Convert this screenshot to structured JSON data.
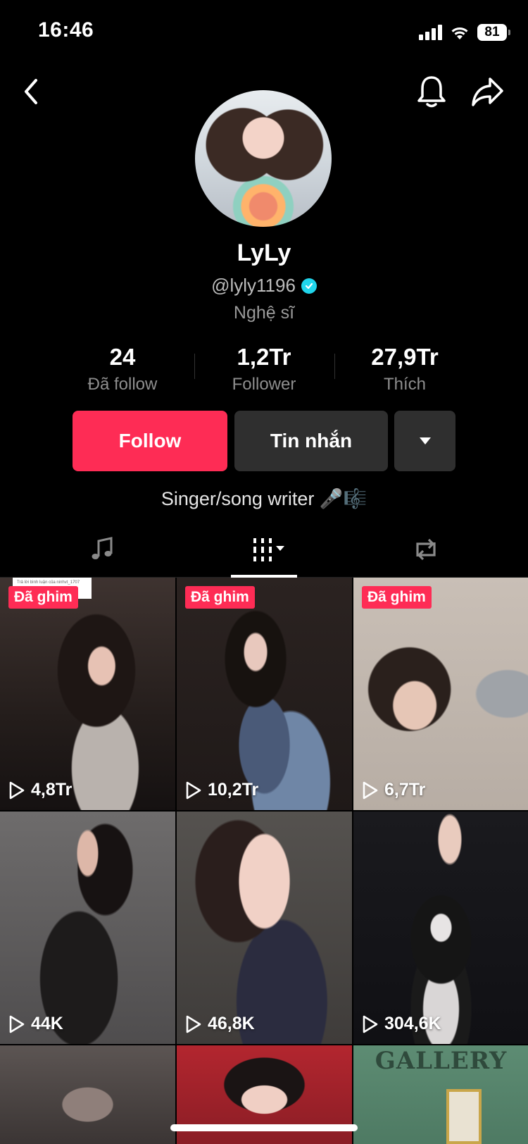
{
  "status_bar": {
    "time": "16:46",
    "battery": "81"
  },
  "profile": {
    "name": "LyLy",
    "handle": "@lyly1196",
    "role": "Nghệ sĩ",
    "bio": "Singer/song writer 🎤🎼"
  },
  "stats": [
    {
      "value": "24",
      "label": "Đã follow"
    },
    {
      "value": "1,2Tr",
      "label": "Follower"
    },
    {
      "value": "27,9Tr",
      "label": "Thích"
    }
  ],
  "actions": {
    "follow_label": "Follow",
    "message_label": "Tin nhắn"
  },
  "tabs": {
    "active": "videos"
  },
  "videos": [
    {
      "views": "4,8Tr",
      "pinned_label": "Đã ghim",
      "sticker": "Trả lời bình luận của ninhvt_1707"
    },
    {
      "views": "10,2Tr",
      "pinned_label": "Đã ghim"
    },
    {
      "views": "6,7Tr",
      "pinned_label": "Đã ghim"
    },
    {
      "views": "44K"
    },
    {
      "views": "46,8K"
    },
    {
      "views": "304,6K"
    },
    {
      "sign_text": "GALLERY"
    }
  ],
  "colors": {
    "accent": "#fe2c55",
    "verified": "#20d5ec",
    "button_dark": "#2f2f2f"
  }
}
